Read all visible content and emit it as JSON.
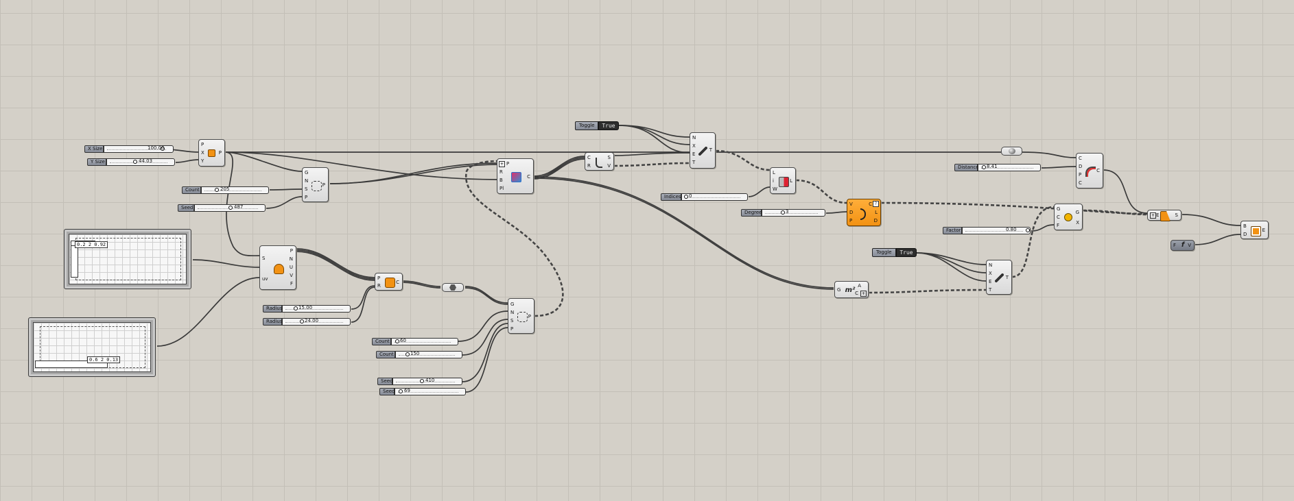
{
  "sliders": {
    "x_size": {
      "label": "X Size",
      "value": "100.00"
    },
    "y_size": {
      "label": "Y Size",
      "value": "44.03"
    },
    "count1": {
      "label": "Count",
      "value": "205"
    },
    "seed1": {
      "label": "Seed",
      "value": "487"
    },
    "radius1": {
      "label": "Radius",
      "value": "15.00"
    },
    "radius2": {
      "label": "Radius",
      "value": "24.00"
    },
    "count2": {
      "label": "Count",
      "value": "60"
    },
    "count3": {
      "label": "Count",
      "value": "150"
    },
    "seed2": {
      "label": "Seed",
      "value": "410"
    },
    "seed3": {
      "label": "Seed",
      "value": "69"
    },
    "indices": {
      "label": "Indices",
      "value": "0"
    },
    "degree": {
      "label": "Degree",
      "value": "3"
    },
    "distance": {
      "label": "Distance",
      "value": "8.41"
    },
    "factor": {
      "label": "Factor",
      "value": "0.80"
    }
  },
  "toggles": {
    "toggle1": {
      "label": "Toggle",
      "value": "True"
    },
    "toggle2": {
      "label": "Toggle",
      "value": "True"
    }
  },
  "graphs": {
    "graph1": {
      "readout": "0.2 2 0.92"
    },
    "graph2": {
      "readout": "0.6 2 0.13"
    }
  },
  "components": {
    "construct_point": {
      "inputs": [
        "P",
        "X",
        "Y"
      ],
      "outputs": [
        "P"
      ]
    },
    "populate_top": {
      "inputs": [
        "G",
        "N",
        "S",
        "P"
      ],
      "outputs": [
        "P"
      ]
    },
    "divide_srf": {
      "inputs": [
        "S",
        "uv"
      ],
      "outputs": [
        "P",
        "N",
        "U",
        "V",
        "F"
      ]
    },
    "circle": {
      "inputs": [
        "P",
        "R"
      ],
      "outputs": [
        "C"
      ]
    },
    "populate_bottom": {
      "inputs": [
        "G",
        "N",
        "S",
        "P"
      ],
      "outputs": [
        "P"
      ]
    },
    "voronoi": {
      "inputs": [
        "P",
        "R",
        "B",
        "Pl"
      ],
      "outputs": [
        "C"
      ]
    },
    "explode": {
      "inputs": [
        "C",
        "R"
      ],
      "outputs": [
        "S",
        "V"
      ]
    },
    "text_tag": {
      "inputs": [
        "N",
        "X",
        "E",
        "T"
      ],
      "outputs": [
        "T"
      ]
    },
    "list_item": {
      "inputs": [
        "L",
        "i",
        "W"
      ],
      "outputs": [
        "L"
      ]
    },
    "nurbs_curve": {
      "inputs": [
        "V",
        "D",
        "P"
      ],
      "outputs": [
        "C",
        "L",
        "D"
      ]
    },
    "area": {
      "inputs": [
        "G"
      ],
      "outputs": [
        "A",
        "C"
      ]
    },
    "text_tag2": {
      "inputs": [
        "N",
        "X",
        "E",
        "T"
      ],
      "outputs": [
        "T"
      ]
    },
    "scale": {
      "inputs": [
        "G",
        "C",
        "F"
      ],
      "outputs": [
        "G",
        "X"
      ]
    },
    "offset": {
      "inputs": [
        "C",
        "D",
        "P",
        "C"
      ],
      "outputs": [
        "C"
      ]
    },
    "extend": {
      "inputs": [
        "E"
      ],
      "outputs": [
        "S"
      ]
    },
    "boundary": {
      "inputs": [
        "B",
        "D"
      ],
      "outputs": [
        "E"
      ]
    },
    "fit": {
      "inputs": [
        "F"
      ],
      "outputs": [
        "V"
      ]
    }
  },
  "colors": {
    "canvas": "#d4d0c8",
    "grid": "#c3bfb7",
    "highlight": "#f29214",
    "wire": "#3a3a3a"
  }
}
